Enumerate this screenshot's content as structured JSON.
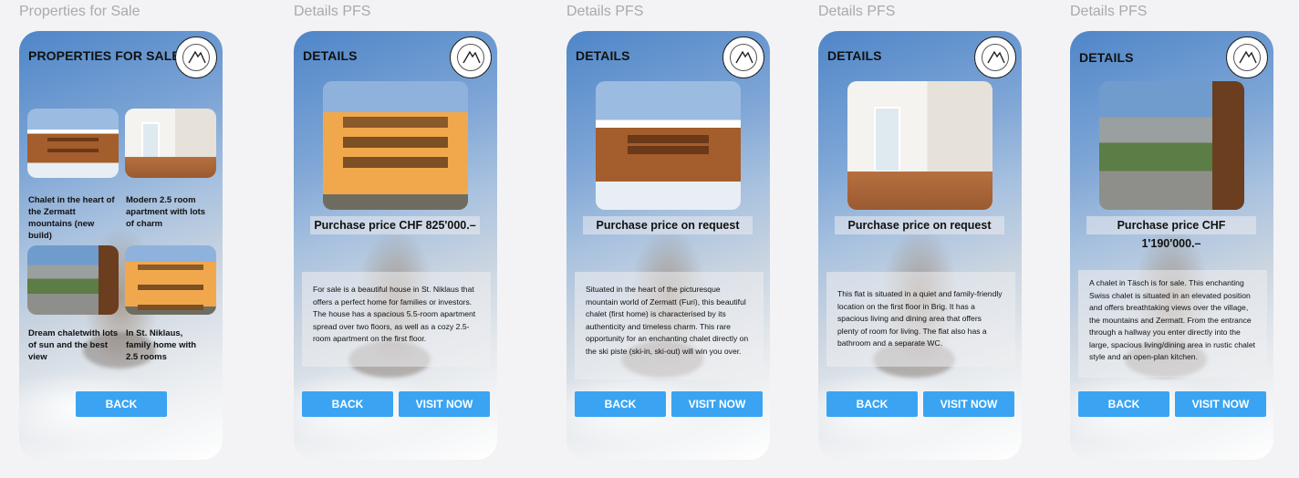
{
  "frames": [
    {
      "label": "Properties for Sale"
    },
    {
      "label": "Details PFS"
    },
    {
      "label": "Details PFS"
    },
    {
      "label": "Details PFS"
    },
    {
      "label": "Details PFS"
    }
  ],
  "list_screen": {
    "title": "PROPERTIES FOR SALE",
    "items": [
      {
        "title": "Chalet in the heart of the Zermatt mountains (new build)",
        "image": "wooden chalet"
      },
      {
        "title": "Modern 2.5 room apartment with lots of charm",
        "image": "empty apartment room"
      },
      {
        "title": "Dream chaletwith lots of sun and the best view",
        "image": "valley village view"
      },
      {
        "title": "In St. Niklaus,  family home with 2.5 rooms",
        "image": "orange house"
      }
    ],
    "back_label": "BACK"
  },
  "details": [
    {
      "title": "DETAILS",
      "price": "Purchase price CHF 825'000.–",
      "description": "For sale is a beautiful house in St. Niklaus that offers a perfect home for families or investors. The house has a spacious 5.5-room apartment spread over two floors, as well as a cozy 2.5-room apartment on the first floor.",
      "image": "orange house",
      "back_label": "BACK",
      "visit_label": "VISIT NOW"
    },
    {
      "title": "DETAILS",
      "price": "Purchase price on request",
      "description": "Situated in the heart of the picturesque mountain world of Zermatt (Furi), this beautiful chalet (first home) is characterised by its authenticity and timeless charm. This rare opportunity for an enchanting chalet directly on the ski piste (ski-in, ski-out) will win you over.",
      "image": "wooden chalet",
      "back_label": "BACK",
      "visit_label": "VISIT NOW"
    },
    {
      "title": "DETAILS",
      "price": "Purchase price on request",
      "description": "This flat is situated in a quiet and family-friendly location on the first floor in Brig. It has a spacious living and dining area that offers plenty of room for living. The flat also has a bathroom and a separate WC.",
      "image": "empty apartment room",
      "back_label": "BACK",
      "visit_label": "VISIT NOW"
    },
    {
      "title": "DETAILS",
      "price": "Purchase price CHF 1'190'000.–",
      "description": "A chalet in Täsch is for sale.  This enchanting Swiss chalet is situated in an elevated position and offers breathtaking views over the village, the mountains and Zermatt. From the entrance through a hallway you enter directly into the large, spacious living/dining area in rustic chalet style and an open-plan kitchen.",
      "image": "valley village view",
      "back_label": "BACK",
      "visit_label": "VISIT NOW"
    }
  ],
  "colors": {
    "button": "#3aa4f2",
    "canvas": "#f3f3f5",
    "label": "#a9a9ae"
  },
  "icons": {
    "logo": "agency-logo-icon"
  }
}
